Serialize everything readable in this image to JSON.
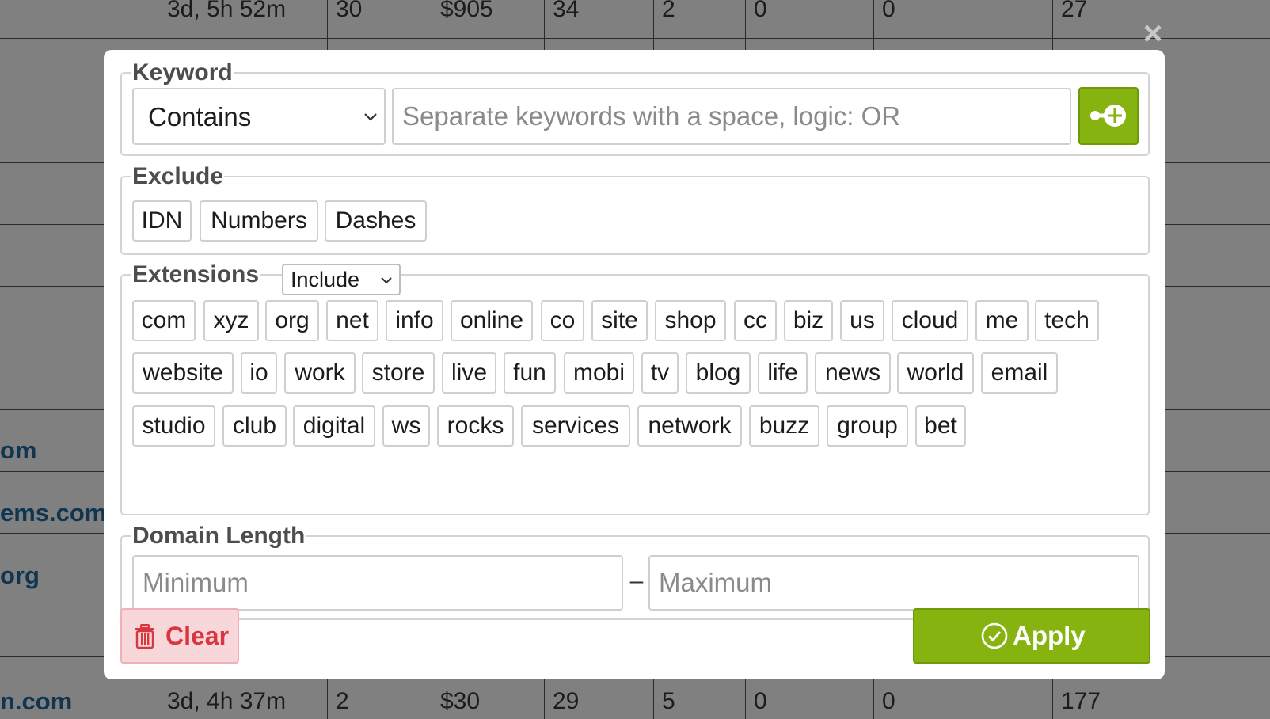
{
  "background_table": {
    "top_row": [
      "3d, 5h 52m",
      "30",
      "$905",
      "34",
      "2",
      "0",
      "0",
      "27"
    ],
    "bottom_row": [
      "3d, 4h 37m",
      "2",
      "$30",
      "29",
      "5",
      "0",
      "0",
      "177"
    ],
    "left_links": [
      "om",
      "ems.com",
      "org",
      "n.com"
    ]
  },
  "close_label": "×",
  "keyword": {
    "legend": "Keyword",
    "mode": "Contains",
    "placeholder": "Separate keywords with a space, logic: OR",
    "add_icon": "add-keyword-icon"
  },
  "exclude": {
    "legend": "Exclude",
    "options": [
      "IDN",
      "Numbers",
      "Dashes"
    ]
  },
  "extensions": {
    "legend": "Extensions",
    "mode": "Include",
    "items": [
      "com",
      "xyz",
      "org",
      "net",
      "info",
      "online",
      "co",
      "site",
      "shop",
      "cc",
      "biz",
      "us",
      "cloud",
      "me",
      "tech",
      "website",
      "io",
      "work",
      "store",
      "live",
      "fun",
      "mobi",
      "tv",
      "blog",
      "life",
      "news",
      "world",
      "email",
      "studio",
      "club",
      "digital",
      "ws",
      "rocks",
      "services",
      "network",
      "buzz",
      "group",
      "bet"
    ]
  },
  "domain_length": {
    "legend": "Domain Length",
    "min_placeholder": "Minimum",
    "separator": "–",
    "max_placeholder": "Maximum"
  },
  "actions": {
    "clear_label": "Clear",
    "clear_icon": "trash-icon",
    "apply_label": "Apply",
    "apply_icon": "check-circle-icon"
  },
  "colors": {
    "accent_green": "#86b30f",
    "danger_red": "#d9373f",
    "danger_bg": "#f8d7da"
  }
}
